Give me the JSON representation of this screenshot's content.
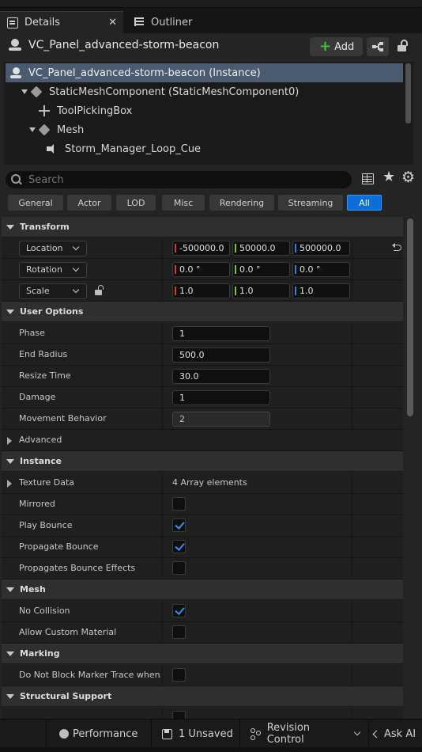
{
  "tabs": [
    {
      "label": "Details",
      "icon": "details-icon"
    },
    {
      "label": "Outliner",
      "icon": "outliner-icon"
    }
  ],
  "header": {
    "title": "VC_Panel_advanced-storm-beacon",
    "add_label": "Add"
  },
  "tree": {
    "items": [
      {
        "label": "VC_Panel_advanced-storm-beacon (Instance)",
        "icon": "actor-icon",
        "selected": true
      },
      {
        "label": "StaticMeshComponent (StaticMeshComponent0)",
        "icon": "cube-icon",
        "expanded": true
      },
      {
        "label": "ToolPickingBox",
        "icon": "tool-icon"
      },
      {
        "label": "Mesh",
        "icon": "cube-icon",
        "expanded": true
      },
      {
        "label": "Storm_Manager_Loop_Cue",
        "icon": "speaker-icon"
      }
    ]
  },
  "search": {
    "placeholder": "Search"
  },
  "filters": [
    "General",
    "Actor",
    "LOD",
    "Misc",
    "Rendering",
    "Streaming",
    "All"
  ],
  "active_filter": "All",
  "transform": {
    "category": "Transform",
    "location": {
      "label": "Location",
      "x": "-500000.0",
      "y": "50000.0",
      "z": "500000.0"
    },
    "rotation": {
      "label": "Rotation",
      "x": "0.0 °",
      "y": "0.0 °",
      "z": "0.0 °"
    },
    "scale": {
      "label": "Scale",
      "x": "1.0",
      "y": "1.0",
      "z": "1.0"
    }
  },
  "user_options": {
    "category": "User Options",
    "phase": {
      "label": "Phase",
      "value": "1"
    },
    "end_radius": {
      "label": "End Radius",
      "value": "500.0"
    },
    "resize_time": {
      "label": "Resize Time",
      "value": "30.0"
    },
    "damage": {
      "label": "Damage",
      "value": "1"
    },
    "movement_behavior": {
      "label": "Movement Behavior",
      "value": "2"
    },
    "advanced": {
      "label": "Advanced"
    }
  },
  "instance": {
    "category": "Instance",
    "texture_data": {
      "label": "Texture Data",
      "value": "4 Array elements"
    },
    "mirrored": {
      "label": "Mirrored",
      "checked": false
    },
    "play_bounce": {
      "label": "Play Bounce",
      "checked": true
    },
    "propagate_bounce": {
      "label": "Propagate Bounce",
      "checked": true
    },
    "propagates_bounce_effects": {
      "label": "Propagates Bounce Effects",
      "checked": false
    }
  },
  "mesh": {
    "category": "Mesh",
    "no_collision": {
      "label": "No Collision",
      "checked": true
    },
    "allow_custom_material": {
      "label": "Allow Custom Material",
      "checked": false
    }
  },
  "marking": {
    "category": "Marking",
    "do_not_block": {
      "label": "Do Not Block Marker Trace when...",
      "checked": false
    }
  },
  "structural_support": {
    "category": "Structural Support"
  },
  "statusbar": {
    "performance": "Performance",
    "unsaved": "1 Unsaved",
    "revision_control": "Revision Control",
    "ask_ai": "Ask AI"
  }
}
